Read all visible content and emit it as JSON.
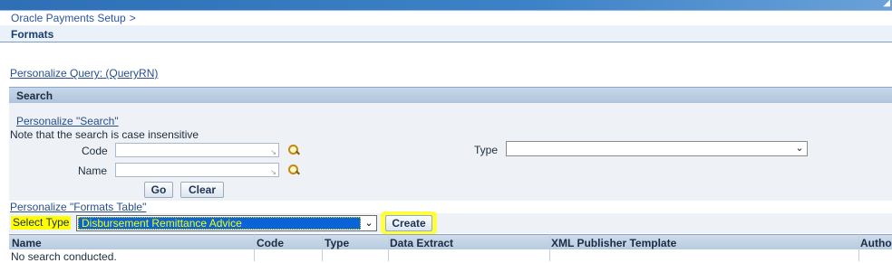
{
  "breadcrumb": {
    "item": "Oracle Payments Setup",
    "separator": ">"
  },
  "page_title": "Formats",
  "personalize_query_link": "Personalize Query: (QueryRN)",
  "search": {
    "header": "Search",
    "personalize_link": "Personalize \"Search\"",
    "note": "Note that the search is case insensitive",
    "code_label": "Code",
    "code_value": "",
    "name_label": "Name",
    "name_value": "",
    "type_label": "Type",
    "type_value": "",
    "go_label": "Go",
    "clear_label": "Clear"
  },
  "formats_table": {
    "personalize_link": "Personalize \"Formats Table\"",
    "select_type_label": "Select Type",
    "select_type_value": "Disbursement Remittance Advice",
    "create_label": "Create",
    "columns": [
      "Name",
      "Code",
      "Type",
      "Data Extract",
      "XML Publisher Template",
      "Autho"
    ],
    "empty_message": "No search conducted."
  },
  "icons": {
    "code_lookup": "search-icon",
    "name_lookup": "search-icon",
    "dropdown": "chevron-down-icon"
  },
  "colors": {
    "highlight": "#ffff00",
    "selection": "#0a64d8",
    "link": "#264e8c"
  }
}
